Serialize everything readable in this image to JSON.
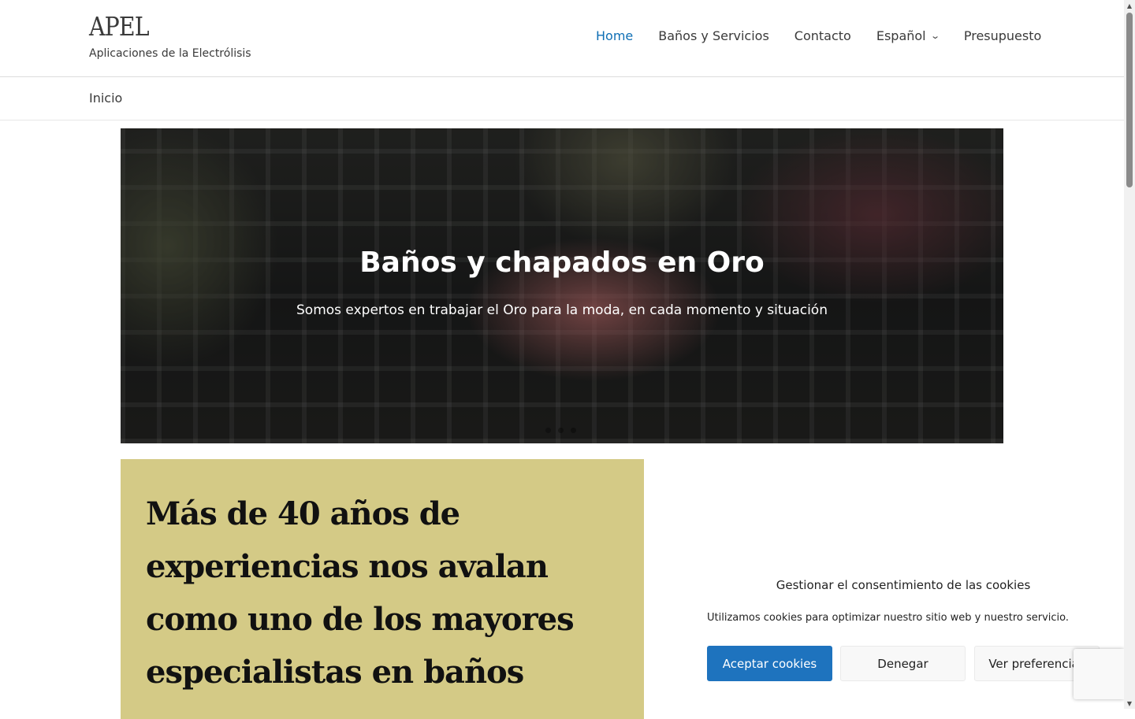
{
  "header": {
    "site_title": "APEL",
    "tagline": "Aplicaciones de la Electrólisis",
    "nav": [
      {
        "label": "Home",
        "active": true
      },
      {
        "label": "Baños y Servicios"
      },
      {
        "label": "Contacto"
      },
      {
        "label": "Español",
        "has_dropdown": true
      },
      {
        "label": "Presupuesto"
      }
    ],
    "active_color": "#0f6fb5"
  },
  "breadcrumb": {
    "items": [
      "Inicio"
    ]
  },
  "hero": {
    "title": "Baños y chapados en Oro",
    "subtitle": "Somos expertos en trabajar el Oro para la moda, en cada momento y situación",
    "slide_count": 3,
    "active_slide": 1
  },
  "feature": {
    "heading": "Más de 40 años de experiencias nos avalan como uno de los mayores especialistas en baños",
    "background_color": "#d4ca86"
  },
  "cookie_banner": {
    "title": "Gestionar el consentimiento de las cookies",
    "text": "Utilizamos cookies para optimizar nuestro sitio web y nuestro servicio.",
    "accept_label": "Aceptar cookies",
    "deny_label": "Denegar",
    "preferences_label": "Ver preferencias",
    "accept_color": "#1e73be"
  },
  "icons": {
    "dropdown": "chevron-down-icon",
    "scroll_up": "arrow-up-icon",
    "scroll_down": "arrow-down-icon"
  }
}
